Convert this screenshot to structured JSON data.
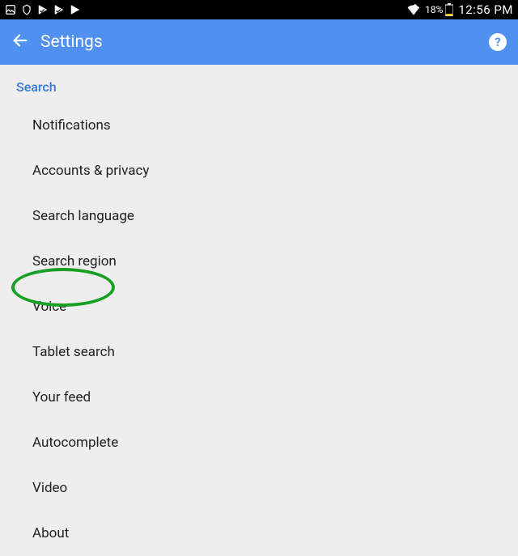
{
  "status": {
    "battery_percent": "18%",
    "time": "12:56 PM"
  },
  "appbar": {
    "title": "Settings",
    "help_glyph": "?"
  },
  "section": {
    "header": "Search",
    "items": [
      "Notifications",
      "Accounts & privacy",
      "Search language",
      "Search region",
      "Voice",
      "Tablet search",
      "Your feed",
      "Autocomplete",
      "Video",
      "About"
    ]
  },
  "annotation": {
    "highlighted_item": "Voice",
    "color": "#17a024"
  }
}
